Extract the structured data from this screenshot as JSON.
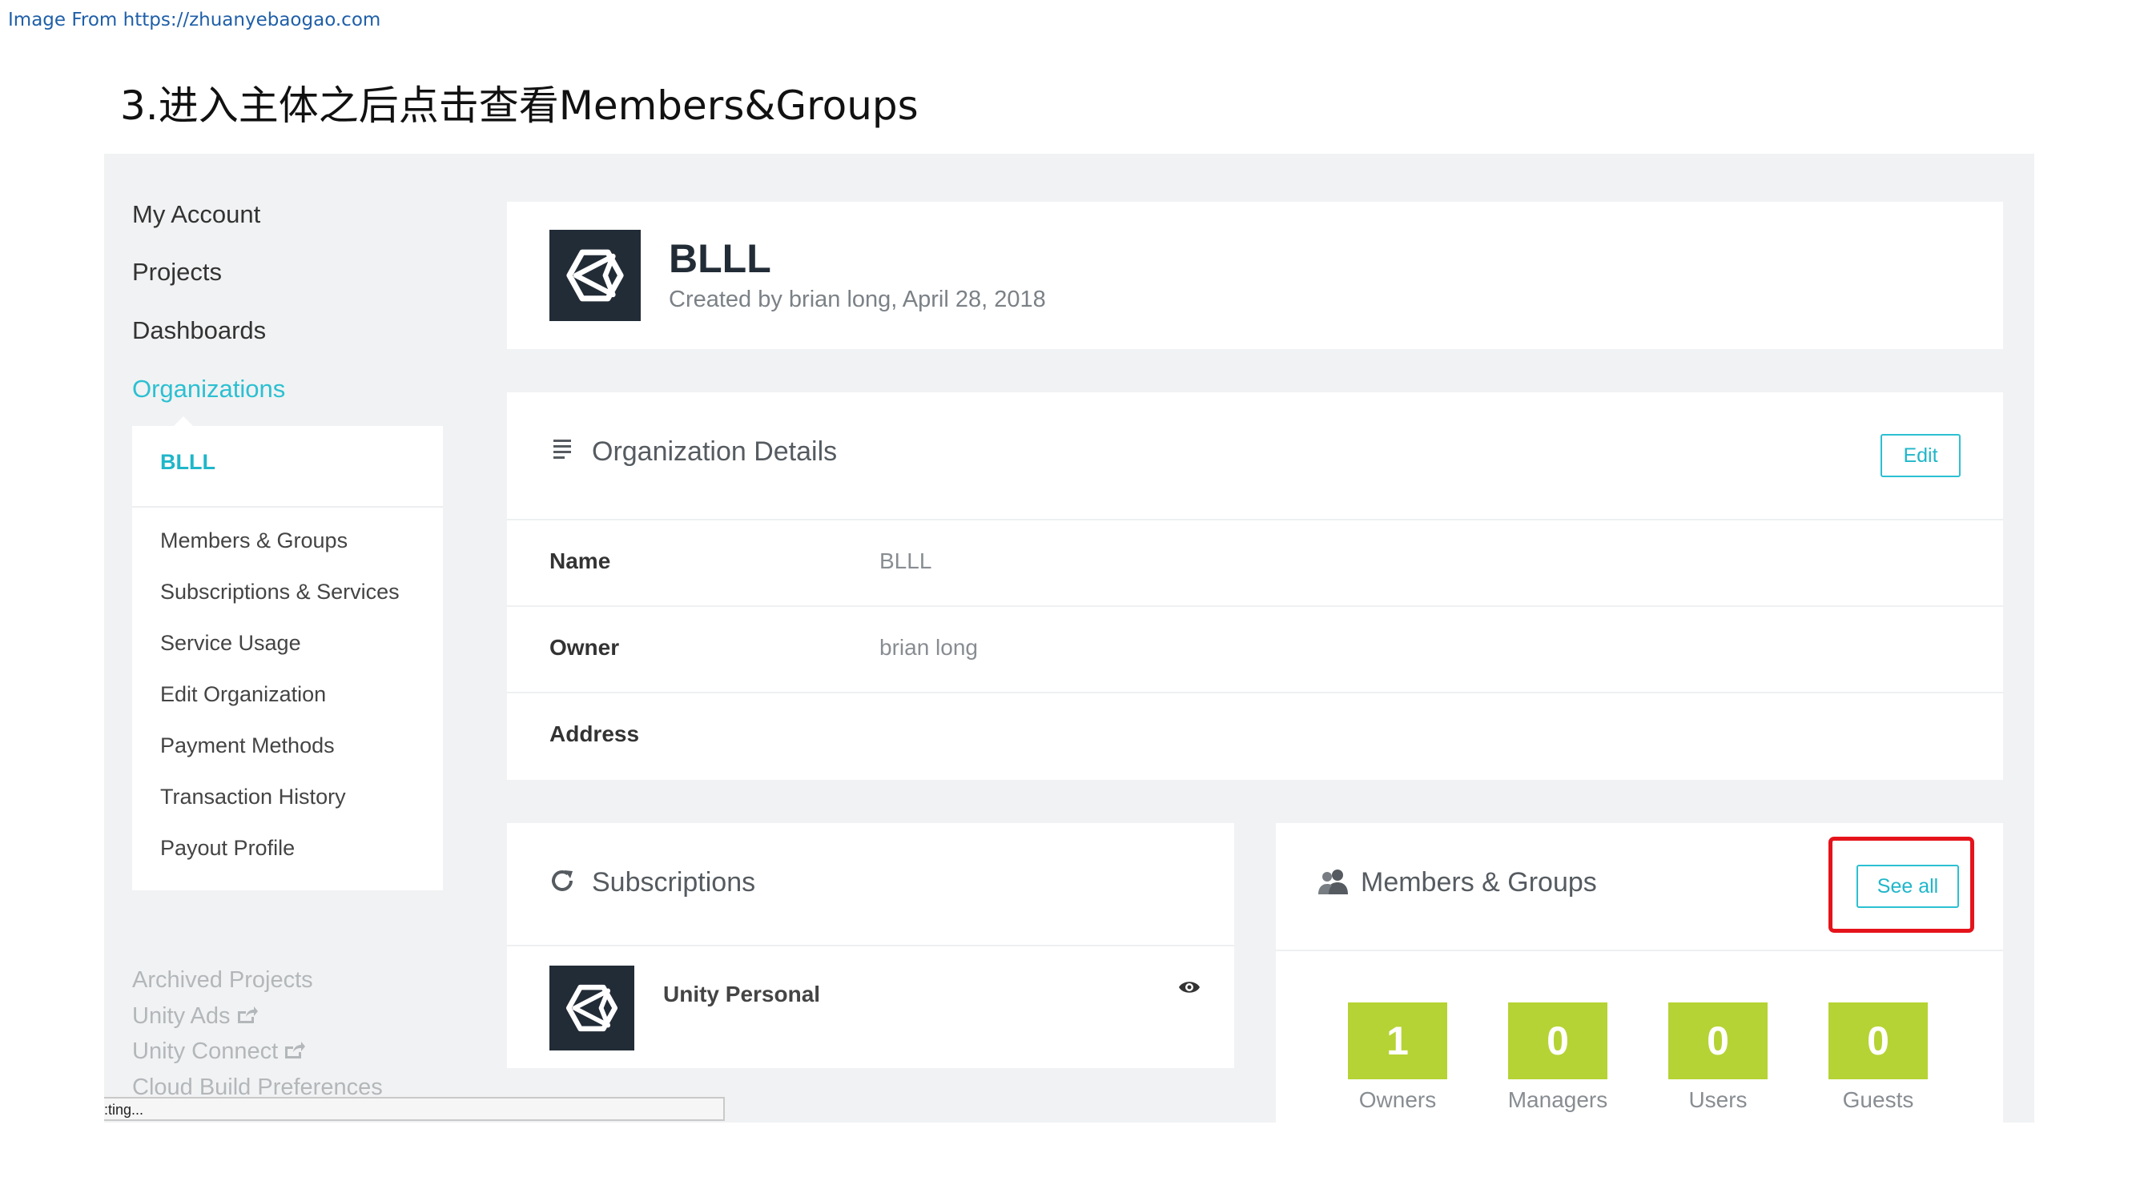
{
  "source_note": "Image From https://zhuanyebaogao.com",
  "step_title": "3.进入主体之后点击查看Members&Groups",
  "sidebar": {
    "nav": [
      "My Account",
      "Projects",
      "Dashboards",
      "Organizations"
    ],
    "active_nav": "Organizations",
    "org_name": "BLLL",
    "sub_items": [
      "Members & Groups",
      "Subscriptions & Services",
      "Service Usage",
      "Edit Organization",
      "Payment Methods",
      "Transaction History",
      "Payout Profile"
    ],
    "extra_links": [
      "Archived Projects",
      "Unity Ads",
      "Unity Connect",
      "Cloud Build Preferences"
    ],
    "status_text": ":ting..."
  },
  "org_header": {
    "title": "BLLL",
    "subtitle": "Created by brian long, April 28, 2018",
    "logo_icon": "unity-logo-icon"
  },
  "details": {
    "title": "Organization Details",
    "edit_label": "Edit",
    "rows": [
      {
        "label": "Name",
        "value": "BLLL"
      },
      {
        "label": "Owner",
        "value": "brian long"
      },
      {
        "label": "Address",
        "value": ""
      }
    ]
  },
  "subscriptions": {
    "title": "Subscriptions",
    "item_name": "Unity Personal"
  },
  "members": {
    "title": "Members & Groups",
    "see_all_label": "See all",
    "stats": [
      {
        "value": "1",
        "label": "Owners"
      },
      {
        "value": "0",
        "label": "Managers"
      },
      {
        "value": "0",
        "label": "Users"
      },
      {
        "value": "0",
        "label": "Guests"
      }
    ]
  },
  "colors": {
    "accent": "#2bc0d2",
    "stat_green": "#b5d334",
    "logo_bg": "#222c37",
    "highlight_red": "#e5131b"
  }
}
